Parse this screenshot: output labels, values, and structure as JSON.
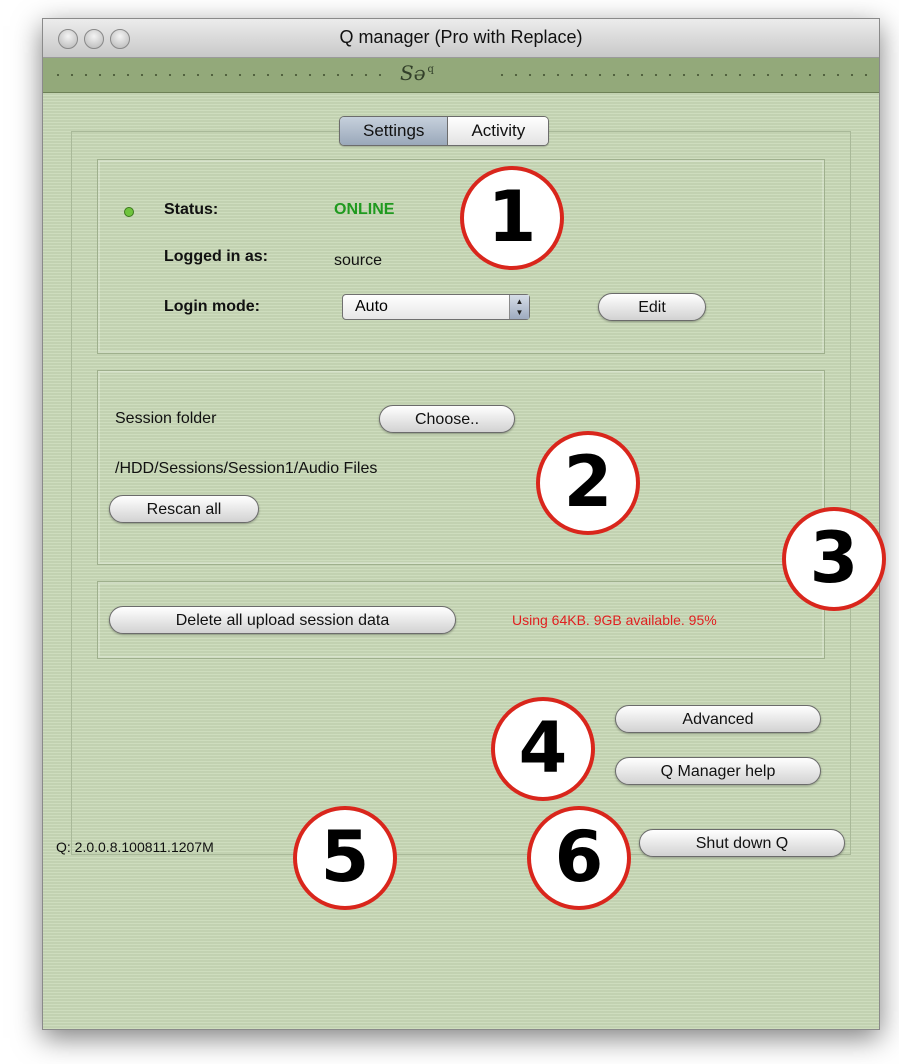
{
  "window": {
    "title": "Q manager (Pro with Replace)",
    "logo": "Sə",
    "logo_sup": "q"
  },
  "tabs": [
    {
      "label": "Settings",
      "active": true
    },
    {
      "label": "Activity",
      "active": false
    }
  ],
  "status_panel": {
    "status_label": "Status:",
    "status_value": "ONLINE",
    "logged_in_label": "Logged in as:",
    "logged_in_value": "source",
    "login_mode_label": "Login mode:",
    "login_mode_value": "Auto",
    "edit_label": "Edit"
  },
  "session_panel": {
    "folder_label": "Session folder",
    "choose_label": "Choose..",
    "path": "/HDD/Sessions/Session1/Audio Files",
    "rescan_label": "Rescan all"
  },
  "upload_panel": {
    "delete_label": "Delete all upload session data",
    "usage_text": "Using 64KB.  9GB available. 95%"
  },
  "buttons": {
    "advanced_label": "Advanced",
    "help_label": "Q Manager help",
    "shutdown_label": "Shut down Q"
  },
  "version": "Q: 2.0.0.8.100811.1207M",
  "callouts": [
    "1",
    "2",
    "3",
    "4",
    "5",
    "6"
  ],
  "colors": {
    "online": "#1f9a1f",
    "usage": "#e02020",
    "callout_ring": "#d9261c",
    "panel_bg": "#c9d9b7"
  },
  "icons": {
    "status": "status-indicator-icon",
    "select": "stepper-arrows-icon"
  }
}
